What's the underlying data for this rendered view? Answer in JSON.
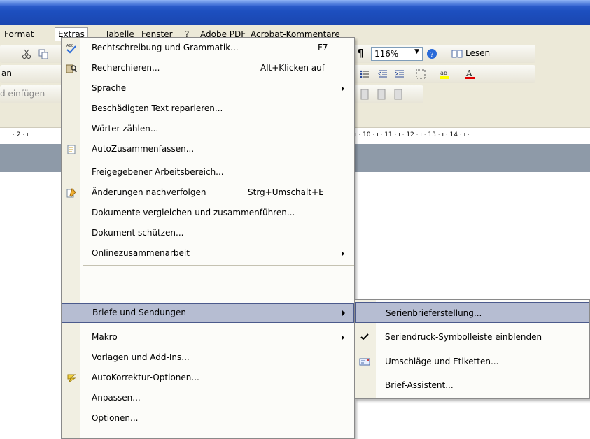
{
  "menubar": {
    "format": "Format",
    "extras": "Extras",
    "tabelle": "Tabelle",
    "fenster": "Fenster",
    "help": "?",
    "adobe_pdf": "Adobe PDF",
    "acrobat_kommentare": "Acrobat-Kommentare"
  },
  "toolbar": {
    "zoom": "116%",
    "lesen_label": "Lesen",
    "font_partial": "an",
    "paste_partial": "d einfügen",
    "pilcrow": "¶"
  },
  "ruler": {
    "left_ticks": "· 2 · ı",
    "right_ticks": "ı · 10 · ı · 11 · ı · 12 · ı · 13 · ı · 14 · ı ·"
  },
  "extras_menu": {
    "items": [
      {
        "label": "Rechtschreibung und Grammatik...",
        "shortcut": "F7",
        "icon": "spellcheck-icon"
      },
      {
        "label": "Recherchieren...",
        "shortcut": "Alt+Klicken auf",
        "icon": "research-icon"
      },
      {
        "label": "Sprache",
        "submenu": true
      },
      {
        "label": "Beschädigten Text reparieren..."
      },
      {
        "label": "Wörter zählen..."
      },
      {
        "label": "AutoZusammenfassen...",
        "icon": "autosummarize-icon"
      },
      {
        "label": "Freigegebener Arbeitsbereich..."
      },
      {
        "label": "Änderungen nachverfolgen",
        "shortcut": "Strg+Umschalt+E",
        "icon": "track-changes-icon"
      },
      {
        "label": "Dokumente vergleichen und zusammenführen..."
      },
      {
        "label": "Dokument schützen..."
      },
      {
        "label": "Onlinezusammenarbeit",
        "submenu": true
      },
      {
        "label": "Briefe und Sendungen",
        "submenu": true,
        "highlighted": true
      },
      {
        "label": "Makro",
        "submenu": true
      },
      {
        "label": "Vorlagen und Add-Ins..."
      },
      {
        "label": "AutoKorrektur-Optionen...",
        "icon": "autocorrect-icon"
      },
      {
        "label": "Anpassen..."
      },
      {
        "label": "Optionen..."
      }
    ]
  },
  "briefe_submenu": {
    "items": [
      {
        "label": "Serienbrieferstellung...",
        "highlighted": true
      },
      {
        "label": "Seriendruck-Symbolleiste einblenden",
        "checked": true
      },
      {
        "label": "Umschläge und Etiketten...",
        "icon": "envelope-icon"
      },
      {
        "label": "Brief-Assistent..."
      }
    ]
  },
  "colors": {
    "titlebar": "#1d4fbf",
    "menu_bg": "#fcfcf9",
    "highlight": "#b6bdd2",
    "highlight_border": "#4b5a8c",
    "chrome": "#ece9d8"
  }
}
